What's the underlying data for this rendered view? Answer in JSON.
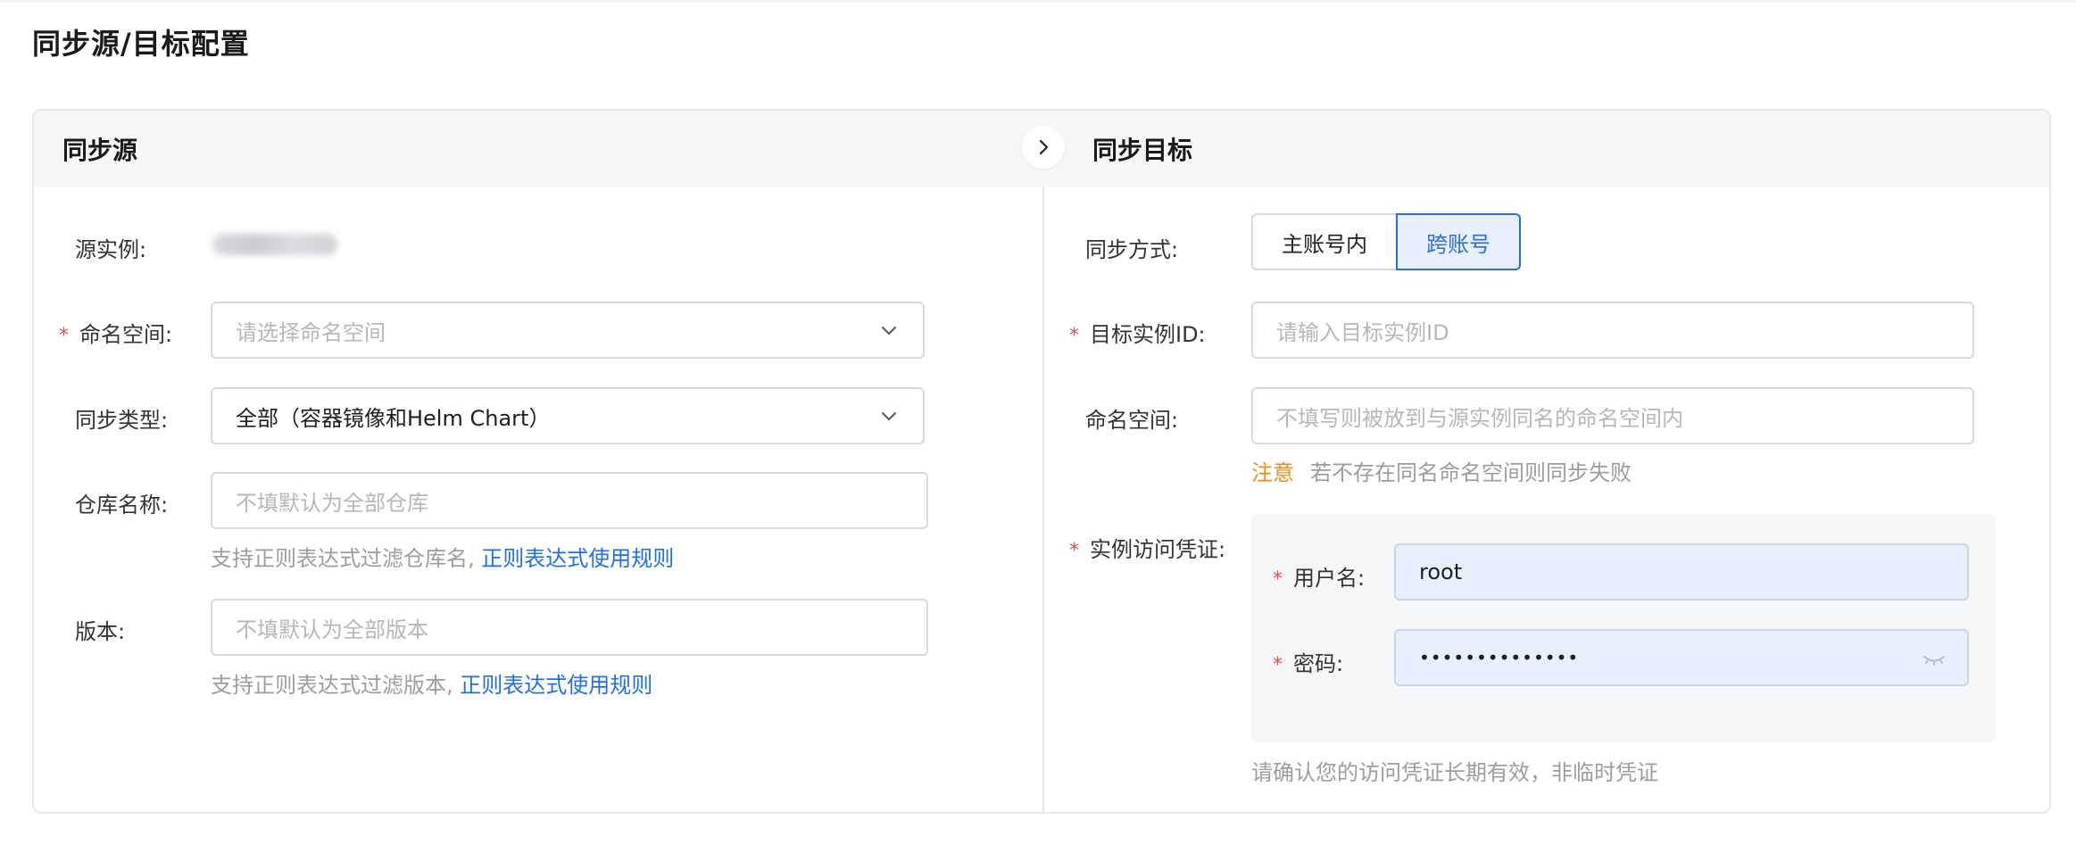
{
  "page": {
    "title": "同步源/目标配置"
  },
  "source": {
    "header": "同步源",
    "instance_label": "源实例:",
    "namespace": {
      "label": "命名空间:",
      "placeholder": "请选择命名空间"
    },
    "sync_type": {
      "label": "同步类型:",
      "value": "全部（容器镜像和Helm Chart）"
    },
    "repo_name": {
      "label": "仓库名称:",
      "placeholder": "不填默认为全部仓库",
      "help": "支持正则表达式过滤仓库名,",
      "help_link": "正则表达式使用规则"
    },
    "version": {
      "label": "版本:",
      "placeholder": "不填默认为全部版本",
      "help": "支持正则表达式过滤版本,",
      "help_link": "正则表达式使用规则"
    }
  },
  "target": {
    "header": "同步目标",
    "sync_mode": {
      "label": "同步方式:",
      "options": [
        "主账号内",
        "跨账号"
      ],
      "selected": "跨账号"
    },
    "instance_id": {
      "label": "目标实例ID:",
      "placeholder": "请输入目标实例ID"
    },
    "namespace": {
      "label": "命名空间:",
      "placeholder": "不填写则被放到与源实例同名的命名空间内",
      "note_tag": "注意",
      "note": "若不存在同名命名空间则同步失败"
    },
    "credentials": {
      "label": "实例访问凭证:",
      "username": {
        "label": "用户名:",
        "value": "root"
      },
      "password": {
        "label": "密码:",
        "value": "••••••••••••••"
      },
      "help": "请确认您的访问凭证长期有效，非临时凭证"
    }
  },
  "required_mark": "*",
  "colors": {
    "accent": "#2c6de6",
    "required": "#e34d4d",
    "warning": "#f08c1a"
  }
}
